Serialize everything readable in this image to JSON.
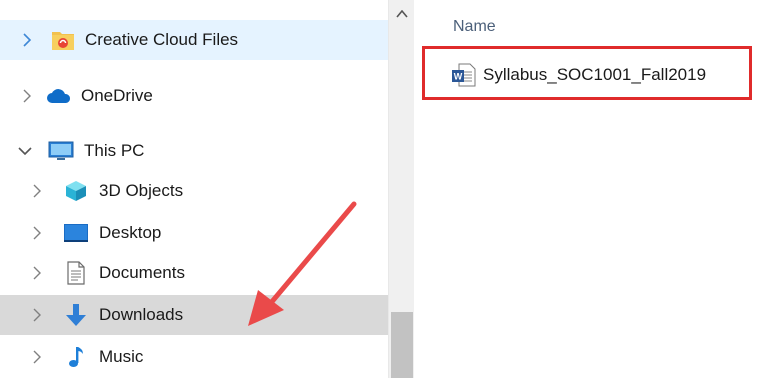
{
  "nav": {
    "items": [
      {
        "label": "Creative Cloud Files",
        "icon": "creative-cloud-folder-icon",
        "expanded": false
      },
      {
        "label": "OneDrive",
        "icon": "onedrive-cloud-icon",
        "expanded": false
      },
      {
        "label": "This PC",
        "icon": "monitor-icon",
        "expanded": true
      },
      {
        "label": "3D Objects",
        "icon": "3d-cube-icon",
        "expanded": false
      },
      {
        "label": "Desktop",
        "icon": "desktop-icon",
        "expanded": false
      },
      {
        "label": "Documents",
        "icon": "documents-icon",
        "expanded": false
      },
      {
        "label": "Downloads",
        "icon": "download-arrow-icon",
        "expanded": false
      },
      {
        "label": "Music",
        "icon": "music-note-icon",
        "expanded": false
      }
    ]
  },
  "content": {
    "column_header": "Name",
    "files": [
      {
        "name": "Syllabus_SOC1001_Fall2019",
        "icon": "word-document-icon"
      }
    ]
  },
  "annotation": {
    "highlight_color": "#e02b2b",
    "arrow_color": "#ea4a4a"
  },
  "colors": {
    "selected_bg": "#e5f3ff",
    "hover_bg": "#d9d9d9",
    "header_text": "#4c607a"
  }
}
